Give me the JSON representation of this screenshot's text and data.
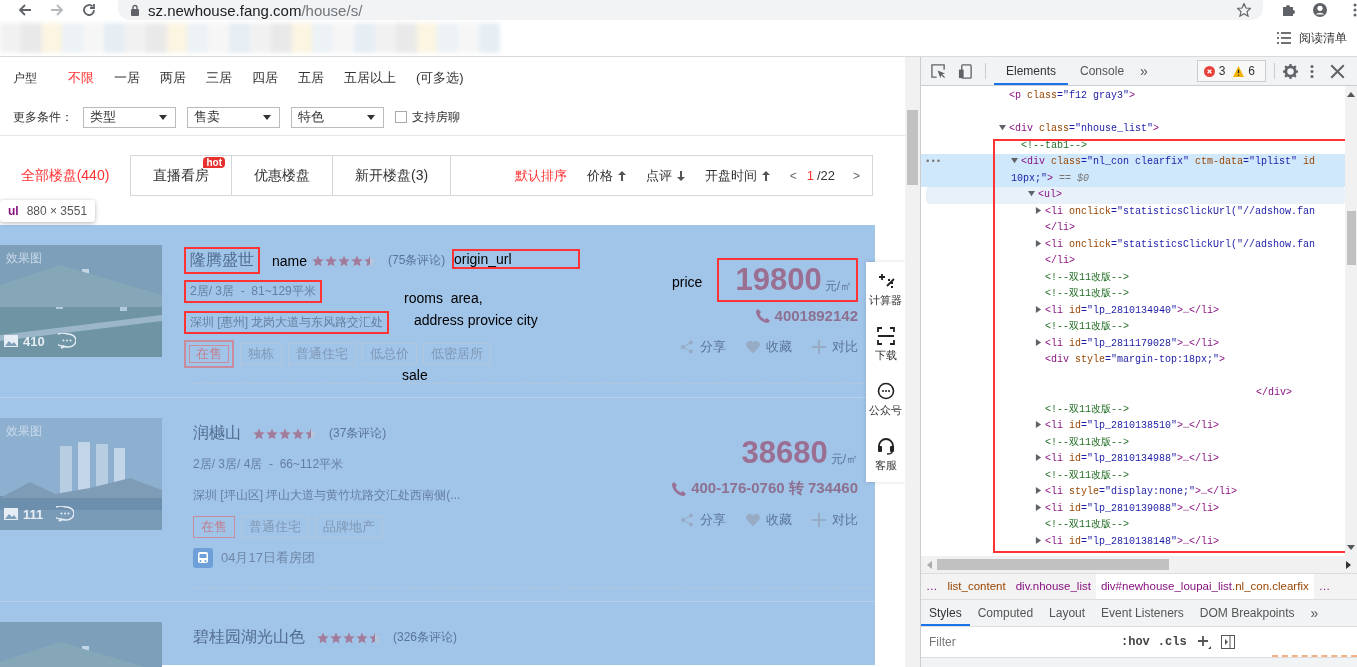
{
  "browser": {
    "url_host": "sz.newhouse.fang.com",
    "url_path": "/house/s/",
    "reading_list": "阅读清单"
  },
  "filters": {
    "label": "户型",
    "options": [
      {
        "label": "不限",
        "selected": true
      },
      {
        "label": "一居",
        "selected": false
      },
      {
        "label": "两居",
        "selected": false
      },
      {
        "label": "三居",
        "selected": false
      },
      {
        "label": "四居",
        "selected": false
      },
      {
        "label": "五居",
        "selected": false
      },
      {
        "label": "五居以上",
        "selected": false
      }
    ],
    "note": "(可多选)"
  },
  "more": {
    "label": "更多条件：",
    "selects": [
      "类型",
      "售卖",
      "特色"
    ],
    "checkbox": {
      "label": "支持房聊",
      "checked": false
    }
  },
  "tabs": [
    {
      "label": "全部楼盘(440)",
      "selected": true
    },
    {
      "label": "直播看房",
      "selected": false,
      "badge": "hot"
    },
    {
      "label": "优惠楼盘",
      "selected": false
    },
    {
      "label": "新开楼盘(3)",
      "selected": false
    }
  ],
  "sort": [
    {
      "label": "默认排序",
      "selected": true
    },
    {
      "label": "价格",
      "selected": false,
      "ascending": true
    },
    {
      "label": "点评",
      "selected": false,
      "ascending": false
    },
    {
      "label": "开盘时间",
      "selected": false,
      "ascending": true
    }
  ],
  "pager": {
    "prev": "<",
    "current": "1",
    "total": "/22",
    "next": ">"
  },
  "inspect_tooltip": {
    "tag": "ul",
    "size": "880 × 3551"
  },
  "listings": [
    {
      "image_label": "效果图",
      "photo_count": "410",
      "name": "隆腾盛世",
      "stars": 4.5,
      "reviews": "(75条评论)",
      "rooms": "2居/ 3居  -  81~129平米",
      "address": "深圳 [惠州] 龙岗大道与东风路交汇处",
      "tags": [
        {
          "label": "在售",
          "kind": "status",
          "marked": true
        },
        {
          "label": "独栋",
          "kind": "feature",
          "marked": false
        },
        {
          "label": "普通住宅",
          "kind": "feature",
          "marked": false
        },
        {
          "label": "低总价",
          "kind": "feature",
          "marked": false
        },
        {
          "label": "低密居所",
          "kind": "feature",
          "marked": false
        }
      ],
      "price": "19800",
      "unit": "元/㎡",
      "phone": "4001892142",
      "actions": [
        "分享",
        "收藏",
        "对比"
      ],
      "marked": {
        "name": true,
        "rooms": true,
        "address": true,
        "price": true
      }
    },
    {
      "image_label": "效果图",
      "photo_count": "111",
      "name": "润樾山",
      "stars": 4.5,
      "reviews": "(37条评论)",
      "rooms": "2居/ 3居/ 4居  -  66~112平米",
      "address": "深圳 [坪山区] 坪山大道与黄竹坑路交汇处西南侧(...",
      "tags": [
        {
          "label": "在售",
          "kind": "status",
          "marked": false
        },
        {
          "label": "普通住宅",
          "kind": "feature",
          "marked": false
        },
        {
          "label": "品牌地产",
          "kind": "feature",
          "marked": false
        }
      ],
      "price": "38680",
      "unit": "元/㎡",
      "phone": "400-176-0760 转 734460",
      "actions": [
        "分享",
        "收藏",
        "对比"
      ],
      "tour": "04月17日看房团",
      "marked": {
        "name": false,
        "rooms": false,
        "address": false,
        "price": false
      }
    },
    {
      "name": "碧桂园湖光山色",
      "stars": 4.5,
      "reviews": "(326条评论)"
    }
  ],
  "annotations": [
    {
      "text": "name",
      "boxed": false
    },
    {
      "text": "origin_url",
      "boxed": true
    },
    {
      "text": "price",
      "boxed": false
    },
    {
      "text": "rooms  area,",
      "boxed": false
    },
    {
      "text": "address provice city",
      "boxed": false
    },
    {
      "text": "sale",
      "boxed": false
    }
  ],
  "side_tools": [
    {
      "label": "计算器"
    },
    {
      "label": "下载"
    },
    {
      "label": "公众号"
    },
    {
      "label": "客服"
    }
  ],
  "devtools": {
    "tabs": [
      {
        "label": "Elements",
        "selected": true
      },
      {
        "label": "Console",
        "selected": false
      }
    ],
    "more": "»",
    "errors": "3",
    "warnings": "6",
    "tree": [
      {
        "selected": false,
        "hovered": false,
        "blank_after": true,
        "tokens": [
          {
            "kind": "tag",
            "text": "<p"
          },
          {
            "kind": "attr",
            "text": " class"
          },
          {
            "kind": "value",
            "text": "=\"f12 gray3\""
          },
          {
            "kind": "tag",
            "text": ">"
          }
        ]
      },
      {
        "expanded": true,
        "selected": false,
        "hovered": false,
        "tokens": [
          {
            "kind": "tag",
            "text": "<div"
          },
          {
            "kind": "attr",
            "text": " class"
          },
          {
            "kind": "value",
            "text": "=\"nhouse_list\""
          },
          {
            "kind": "tag",
            "text": ">"
          }
        ],
        "children": [
          {
            "selected": false,
            "hovered": false,
            "tokens": [
              {
                "kind": "comment",
                "text": "<!--tab1-->"
              }
            ]
          },
          {
            "expanded": true,
            "selected": true,
            "hovered": false,
            "marker": "•••",
            "tokens": [
              {
                "kind": "tag",
                "text": "<div"
              },
              {
                "kind": "attr",
                "text": " class"
              },
              {
                "kind": "value",
                "text": "=\"nl_con clearfix\""
              },
              {
                "kind": "attr",
                "text": " ctm-data"
              },
              {
                "kind": "value",
                "text": "=\"lplist\""
              },
              {
                "kind": "attr",
                "text": " id"
              }
            ],
            "wrap": [
              {
                "kind": "value",
                "text": "10px;\""
              },
              {
                "kind": "tag",
                "text": ">"
              },
              {
                "kind": "ref",
                "text": " == $0"
              }
            ],
            "children": [
              {
                "expanded": true,
                "selected": false,
                "hovered": true,
                "tokens": [
                  {
                    "kind": "tag",
                    "text": "<ul>"
                  }
                ],
                "children": [
                  {
                    "expanded": false,
                    "selected": false,
                    "hovered": false,
                    "tokens": [
                      {
                        "kind": "tag",
                        "text": "<li"
                      },
                      {
                        "kind": "attr",
                        "text": " onclick"
                      },
                      {
                        "kind": "value",
                        "text": "=\"statisticsClickUrl(\"//adshow.fan"
                      }
                    ]
                  },
                  {
                    "selected": false,
                    "hovered": false,
                    "tokens": [
                      {
                        "kind": "tag",
                        "text": "</li>"
                      }
                    ]
                  },
                  {
                    "expanded": false,
                    "selected": false,
                    "hovered": false,
                    "tokens": [
                      {
                        "kind": "tag",
                        "text": "<li"
                      },
                      {
                        "kind": "attr",
                        "text": " onclick"
                      },
                      {
                        "kind": "value",
                        "text": "=\"statisticsClickUrl(\"//adshow.fan"
                      }
                    ]
                  },
                  {
                    "selected": false,
                    "hovered": false,
                    "tokens": [
                      {
                        "kind": "tag",
                        "text": "</li>"
                      }
                    ]
                  },
                  {
                    "selected": false,
                    "hovered": false,
                    "tokens": [
                      {
                        "kind": "comment",
                        "text": "<!--双11改版-->"
                      }
                    ]
                  },
                  {
                    "selected": false,
                    "hovered": false,
                    "tokens": [
                      {
                        "kind": "comment",
                        "text": "<!--双11改版-->"
                      }
                    ]
                  },
                  {
                    "expanded": false,
                    "selected": false,
                    "hovered": false,
                    "tokens": [
                      {
                        "kind": "tag",
                        "text": "<li"
                      },
                      {
                        "kind": "attr",
                        "text": " id"
                      },
                      {
                        "kind": "value",
                        "text": "=\"lp_2810134940\""
                      },
                      {
                        "kind": "tag",
                        "text": ">…</li>"
                      }
                    ]
                  },
                  {
                    "selected": false,
                    "hovered": false,
                    "tokens": [
                      {
                        "kind": "comment",
                        "text": "<!--双11改版-->"
                      }
                    ]
                  },
                  {
                    "expanded": false,
                    "selected": false,
                    "hovered": false,
                    "tokens": [
                      {
                        "kind": "tag",
                        "text": "<li"
                      },
                      {
                        "kind": "attr",
                        "text": " id"
                      },
                      {
                        "kind": "value",
                        "text": "=\"lp_2811179028\""
                      },
                      {
                        "kind": "tag",
                        "text": ">…</li>"
                      }
                    ]
                  },
                  {
                    "selected": false,
                    "hovered": false,
                    "tokens": [
                      {
                        "kind": "tag",
                        "text": "<div"
                      },
                      {
                        "kind": "attr",
                        "text": " style"
                      },
                      {
                        "kind": "value",
                        "text": "=\"margin-top:18px;\""
                      },
                      {
                        "kind": "tag",
                        "text": ">"
                      }
                    ],
                    "far": [
                      {
                        "kind": "tag",
                        "text": "</div>"
                      }
                    ]
                  },
                  {
                    "selected": false,
                    "hovered": false,
                    "tokens": [
                      {
                        "kind": "comment",
                        "text": "<!--双11改版-->"
                      }
                    ]
                  },
                  {
                    "expanded": false,
                    "selected": false,
                    "hovered": false,
                    "tokens": [
                      {
                        "kind": "tag",
                        "text": "<li"
                      },
                      {
                        "kind": "attr",
                        "text": " id"
                      },
                      {
                        "kind": "value",
                        "text": "=\"lp_2810138510\""
                      },
                      {
                        "kind": "tag",
                        "text": ">…</li>"
                      }
                    ]
                  },
                  {
                    "selected": false,
                    "hovered": false,
                    "tokens": [
                      {
                        "kind": "comment",
                        "text": "<!--双11改版-->"
                      }
                    ]
                  },
                  {
                    "expanded": false,
                    "selected": false,
                    "hovered": false,
                    "tokens": [
                      {
                        "kind": "tag",
                        "text": "<li"
                      },
                      {
                        "kind": "attr",
                        "text": " id"
                      },
                      {
                        "kind": "value",
                        "text": "=\"lp_2810134988\""
                      },
                      {
                        "kind": "tag",
                        "text": ">…</li>"
                      }
                    ]
                  },
                  {
                    "selected": false,
                    "hovered": false,
                    "tokens": [
                      {
                        "kind": "comment",
                        "text": "<!--双11改版-->"
                      }
                    ]
                  },
                  {
                    "expanded": false,
                    "selected": false,
                    "hovered": false,
                    "tokens": [
                      {
                        "kind": "tag",
                        "text": "<li"
                      },
                      {
                        "kind": "attr",
                        "text": " style"
                      },
                      {
                        "kind": "value",
                        "text": "=\"display:none;\""
                      },
                      {
                        "kind": "tag",
                        "text": ">…</li>"
                      }
                    ]
                  },
                  {
                    "expanded": false,
                    "selected": false,
                    "hovered": false,
                    "tokens": [
                      {
                        "kind": "tag",
                        "text": "<li"
                      },
                      {
                        "kind": "attr",
                        "text": " id"
                      },
                      {
                        "kind": "value",
                        "text": "=\"lp_2810139088\""
                      },
                      {
                        "kind": "tag",
                        "text": ">…</li>"
                      }
                    ]
                  },
                  {
                    "selected": false,
                    "hovered": false,
                    "tokens": [
                      {
                        "kind": "comment",
                        "text": "<!--双11改版-->"
                      }
                    ]
                  },
                  {
                    "expanded": false,
                    "selected": false,
                    "hovered": false,
                    "tokens": [
                      {
                        "kind": "tag",
                        "text": "<li"
                      },
                      {
                        "kind": "attr",
                        "text": " id"
                      },
                      {
                        "kind": "value",
                        "text": "=\"lp_2810138148\""
                      },
                      {
                        "kind": "tag",
                        "text": ">…</li>"
                      }
                    ]
                  }
                ]
              }
            ]
          }
        ]
      }
    ],
    "breadcrumbs": [
      {
        "selected": false,
        "tokens": [
          {
            "kind": "tag",
            "text": "…"
          }
        ]
      },
      {
        "selected": false,
        "tokens": [
          {
            "kind": "attr",
            "text": "list_content"
          }
        ]
      },
      {
        "selected": false,
        "tokens": [
          {
            "kind": "tag",
            "text": "div.nhouse_list"
          }
        ]
      },
      {
        "selected": true,
        "tokens": [
          {
            "kind": "tag",
            "text": "div#newhouse_loupai_list"
          },
          {
            "kind": "attr",
            "text": ".nl_con.clearfix"
          }
        ]
      },
      {
        "selected": false,
        "tokens": [
          {
            "kind": "tag",
            "text": "…"
          }
        ]
      }
    ],
    "pane_tabs": [
      {
        "label": "Styles",
        "selected": true
      },
      {
        "label": "Computed",
        "selected": false
      },
      {
        "label": "Layout",
        "selected": false
      },
      {
        "label": "Event Listeners",
        "selected": false
      },
      {
        "label": "DOM Breakpoints",
        "selected": false
      }
    ],
    "pane_more": "»",
    "filter_placeholder": "Filter",
    "hov": ":hov",
    "cls": ".cls"
  }
}
